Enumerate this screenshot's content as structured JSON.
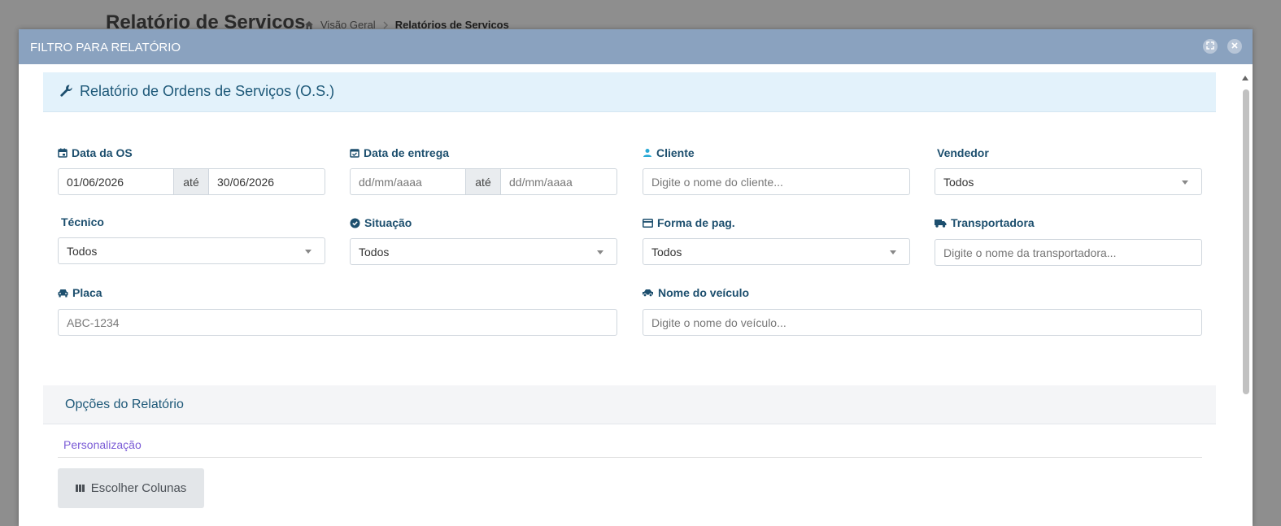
{
  "background": {
    "page_title": "Relatório de Servicos",
    "breadcrumb": {
      "home": "Visão Geral",
      "current": "Relatórios de Servicos"
    }
  },
  "modal": {
    "title": "FILTRO PARA RELATÓRIO"
  },
  "section": {
    "title": "Relatório de Ordens de Serviços (O.S.)",
    "icon": "wrench-icon"
  },
  "filters": {
    "data_os": {
      "label": "Data da OS",
      "from": "01/06/2026",
      "sep": "até",
      "to": "30/06/2026"
    },
    "data_entrega": {
      "label": "Data de entrega",
      "from_placeholder": "dd/mm/aaaa",
      "sep": "até",
      "to_placeholder": "dd/mm/aaaa"
    },
    "cliente": {
      "label": "Cliente",
      "placeholder": "Digite o nome do cliente..."
    },
    "vendedor": {
      "label": "Vendedor",
      "value": "Todos"
    },
    "tecnico": {
      "label": "Técnico",
      "value": "Todos"
    },
    "situacao": {
      "label": "Situação",
      "value": "Todos"
    },
    "forma_pag": {
      "label": "Forma de pag.",
      "value": "Todos"
    },
    "transportadora": {
      "label": "Transportadora",
      "placeholder": "Digite o nome da transportadora..."
    },
    "placa": {
      "label": "Placa",
      "placeholder": "ABC-1234"
    },
    "nome_veiculo": {
      "label": "Nome do veículo",
      "placeholder": "Digite o nome do veículo..."
    }
  },
  "options": {
    "title": "Opções do Relatório",
    "tab": "Personalização",
    "choose_columns": "Escolher Colunas"
  },
  "colors": {
    "header": "#8aa2bf",
    "label": "#1d4f6e",
    "section_bg": "#e3f2fb",
    "accent_link": "#7b5cd6"
  }
}
